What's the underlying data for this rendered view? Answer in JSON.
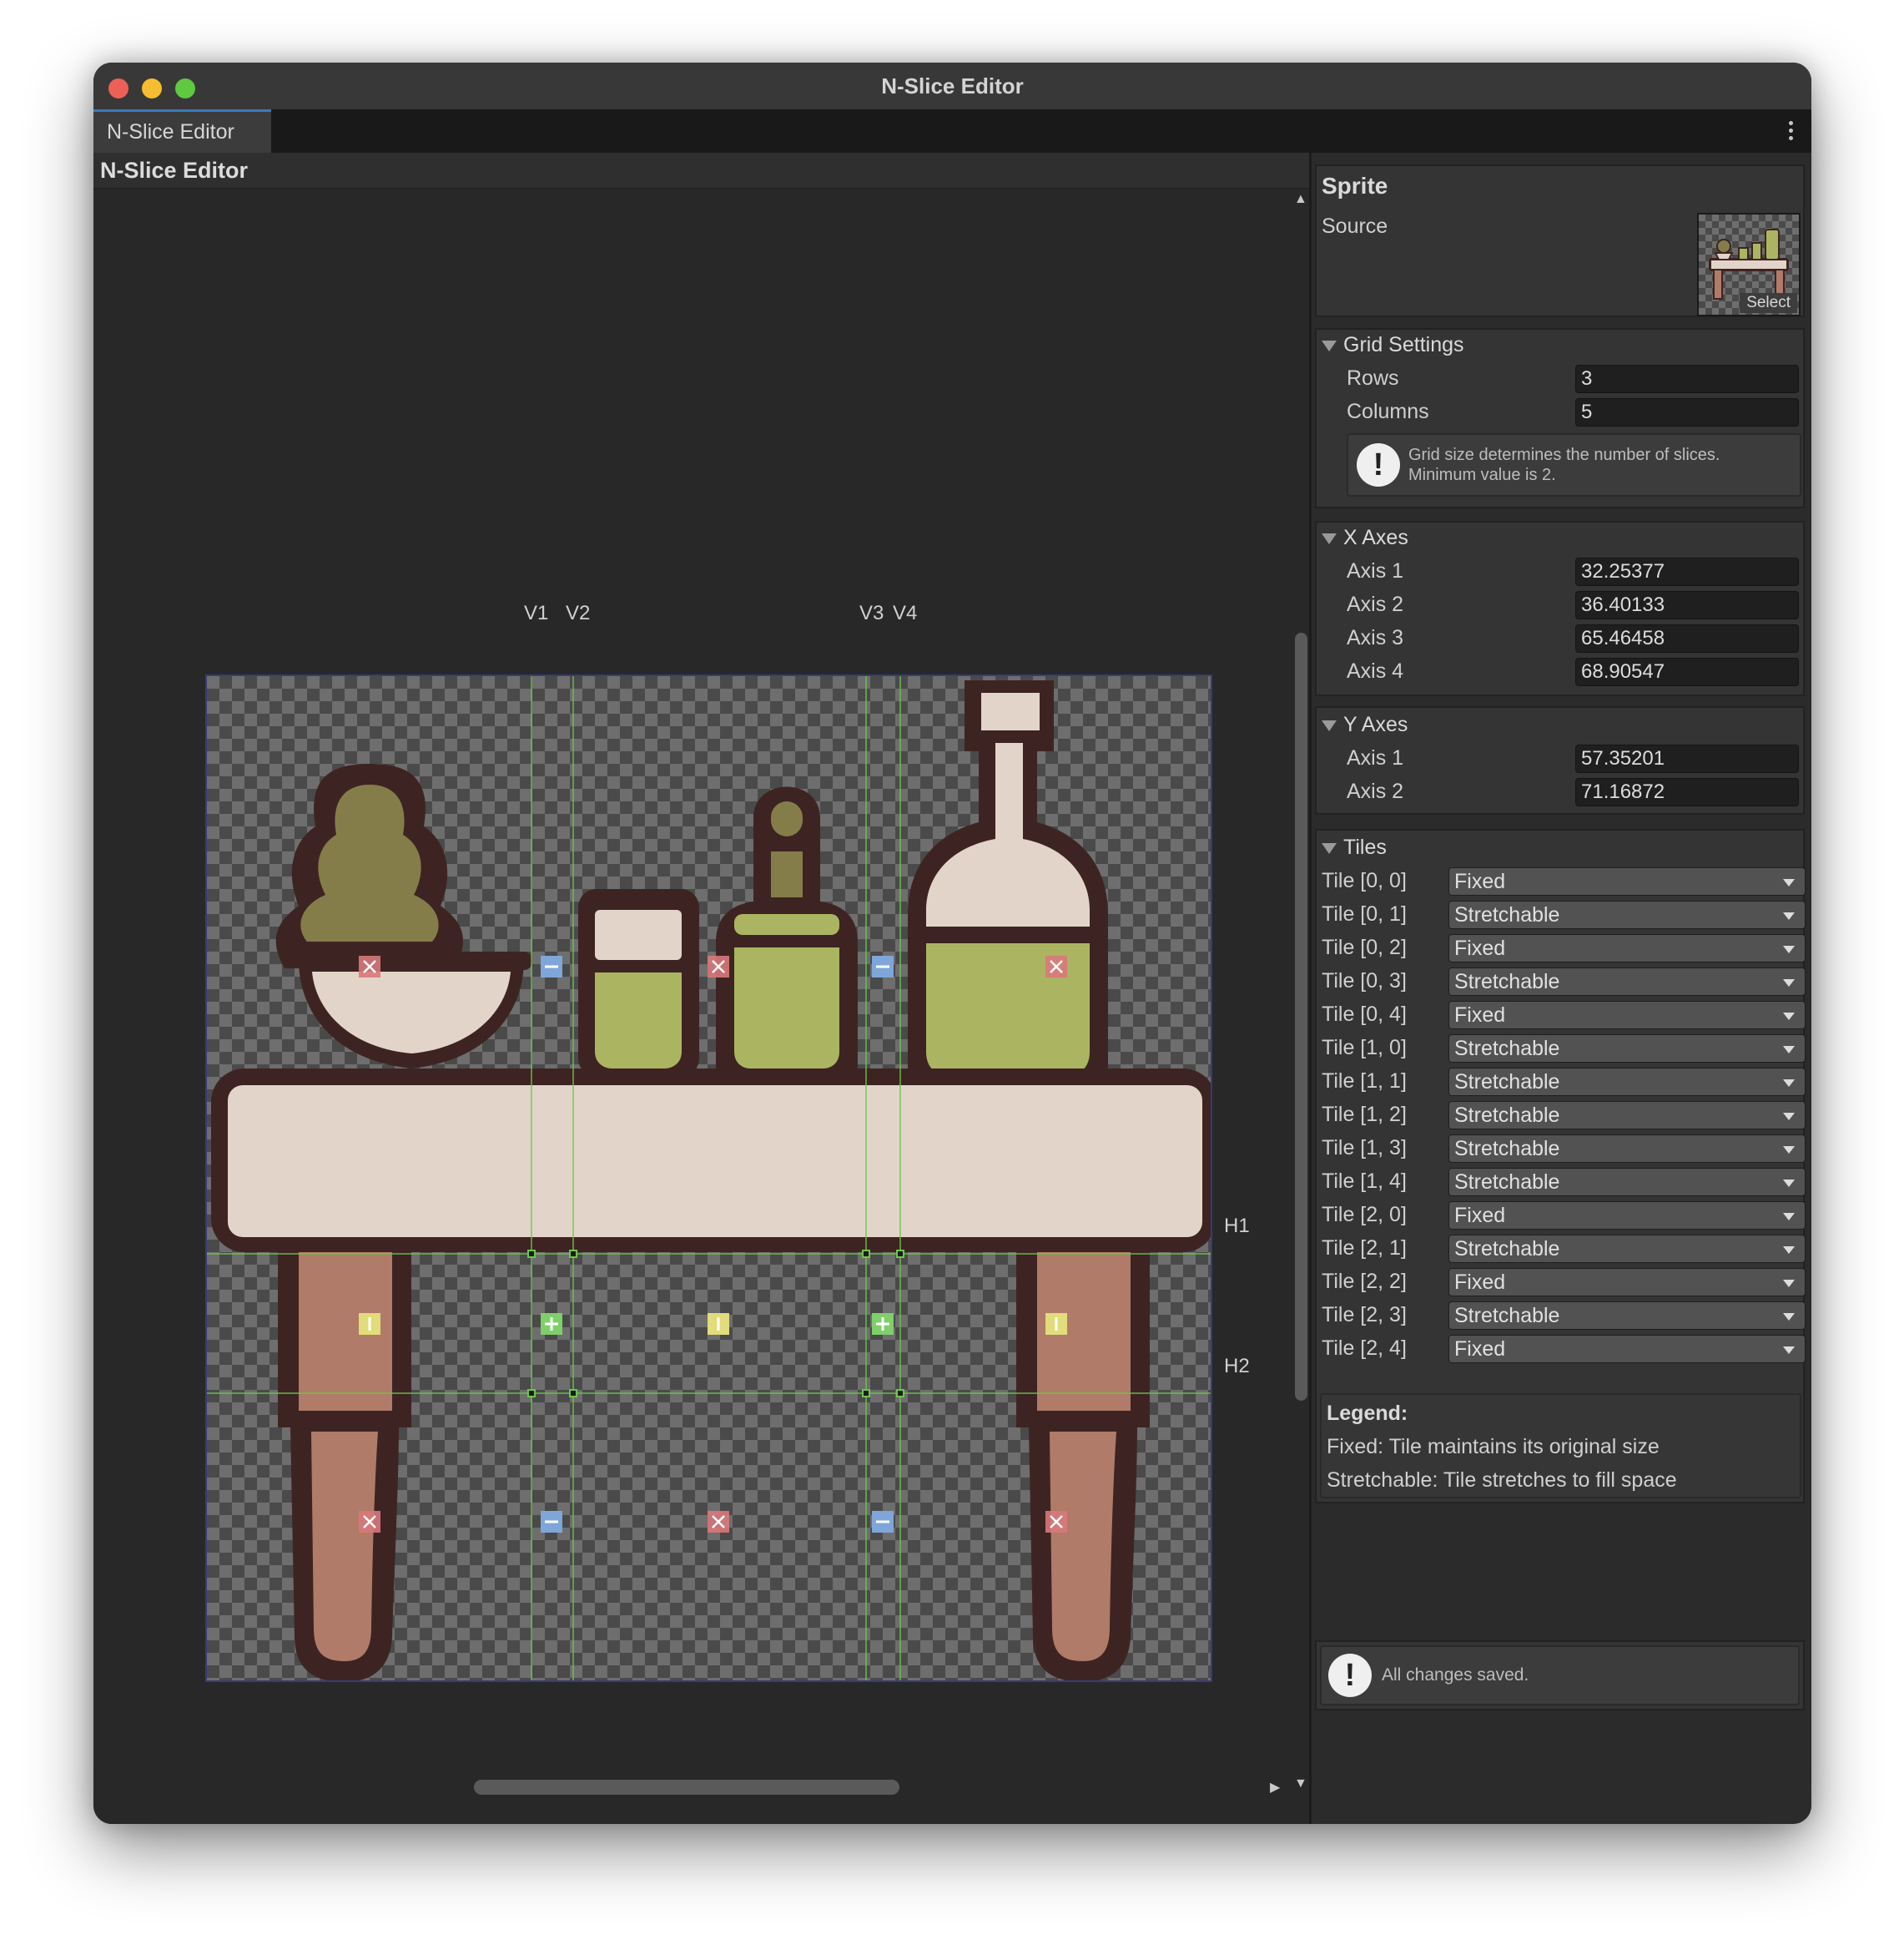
{
  "window": {
    "title": "N-Slice Editor",
    "tab_label": "N-Slice Editor",
    "pane_title": "N-Slice Editor",
    "traffic_colors": {
      "close": "#ee5f57",
      "minimize": "#f5bd2f",
      "maximize": "#5fc93f"
    }
  },
  "canvas": {
    "vertical_labels": [
      "V1",
      "V2",
      "V3",
      "V4"
    ],
    "horizontal_labels": [
      "H1",
      "H2"
    ],
    "guide_color": "#6cc84a",
    "marker_colors": {
      "fixed": "#d9787a",
      "horizontal": "#7fa6d8",
      "vertical": "#e2dc7a",
      "both": "#7fcf6a"
    }
  },
  "sprite": {
    "title": "Sprite",
    "source_label": "Source",
    "select_label": "Select"
  },
  "grid_settings": {
    "title": "Grid Settings",
    "rows_label": "Rows",
    "rows_value": "3",
    "columns_label": "Columns",
    "columns_value": "5",
    "help_line1": "Grid size determines the number of slices.",
    "help_line2": "Minimum value is 2."
  },
  "x_axes": {
    "title": "X Axes",
    "items": [
      {
        "label": "Axis 1",
        "value": "32.25377"
      },
      {
        "label": "Axis 2",
        "value": "36.40133"
      },
      {
        "label": "Axis 3",
        "value": "65.46458"
      },
      {
        "label": "Axis 4",
        "value": "68.90547"
      }
    ]
  },
  "y_axes": {
    "title": "Y Axes",
    "items": [
      {
        "label": "Axis 1",
        "value": "57.35201"
      },
      {
        "label": "Axis 2",
        "value": "71.16872"
      }
    ]
  },
  "tiles": {
    "title": "Tiles",
    "items": [
      {
        "label": "Tile [0, 0]",
        "value": "Fixed"
      },
      {
        "label": "Tile [0, 1]",
        "value": "Stretchable"
      },
      {
        "label": "Tile [0, 2]",
        "value": "Fixed"
      },
      {
        "label": "Tile [0, 3]",
        "value": "Stretchable"
      },
      {
        "label": "Tile [0, 4]",
        "value": "Fixed"
      },
      {
        "label": "Tile [1, 0]",
        "value": "Stretchable"
      },
      {
        "label": "Tile [1, 1]",
        "value": "Stretchable"
      },
      {
        "label": "Tile [1, 2]",
        "value": "Stretchable"
      },
      {
        "label": "Tile [1, 3]",
        "value": "Stretchable"
      },
      {
        "label": "Tile [1, 4]",
        "value": "Stretchable"
      },
      {
        "label": "Tile [2, 0]",
        "value": "Fixed"
      },
      {
        "label": "Tile [2, 1]",
        "value": "Stretchable"
      },
      {
        "label": "Tile [2, 2]",
        "value": "Fixed"
      },
      {
        "label": "Tile [2, 3]",
        "value": "Stretchable"
      },
      {
        "label": "Tile [2, 4]",
        "value": "Fixed"
      }
    ]
  },
  "legend": {
    "title": "Legend:",
    "fixed": "Fixed: Tile maintains its original size",
    "stretchable": "Stretchable: Tile stretches to fill space"
  },
  "status": {
    "message": "All changes saved."
  }
}
